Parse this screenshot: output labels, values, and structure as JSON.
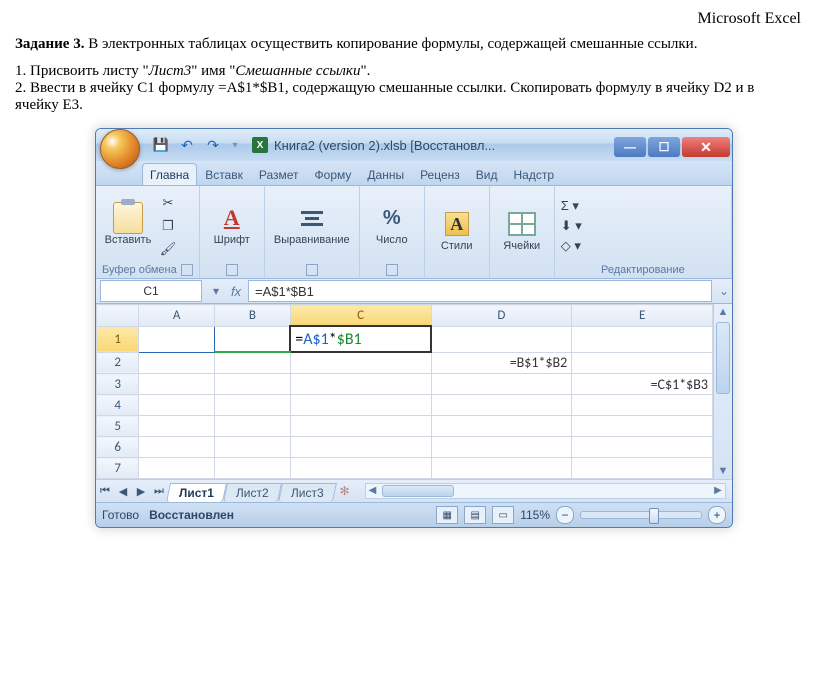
{
  "page": {
    "top_label": "Microsoft Excel",
    "task_title": "Задание 3.",
    "task_text": " В электронных таблицах осуществить копирование формулы, содержащей смешанные ссылки.",
    "step1_a": "1. Присвоить листу \"",
    "step1_i1": "Лист3",
    "step1_b": "\" имя \"",
    "step1_i2": "Смешанные ссылки",
    "step1_c": "\".",
    "step2": "2. Ввести в ячейку С1 формулу =A$1*$B1, содержащую смешанные ссылки. Скопировать формулу в ячейку D2 и в ячейку Е3."
  },
  "window": {
    "title": "Книга2 (version 2).xlsb [Восстановл...",
    "tabs": [
      "Главна",
      "Вставк",
      "Размет",
      "Форму",
      "Данны",
      "Реценз",
      "Вид",
      "Надстр"
    ],
    "groups": {
      "clipboard": {
        "paste": "Вставить",
        "label": "Буфер обмена"
      },
      "font": {
        "btn": "Шрифт"
      },
      "align": {
        "btn": "Выравнивание"
      },
      "number": {
        "btn": "Число"
      },
      "styles": {
        "btn": "Стили"
      },
      "cells": {
        "btn": "Ячейки"
      },
      "editing": {
        "label": "Редактирование"
      }
    },
    "namebox": "C1",
    "formula": "=A$1*$B1",
    "columns": [
      "A",
      "B",
      "C",
      "D",
      "E"
    ],
    "rows": [
      "1",
      "2",
      "3",
      "4",
      "5",
      "6",
      "7"
    ],
    "c1": {
      "eq": "=",
      "ref1": "A$1",
      "op": "*",
      "ref2": "$B1"
    },
    "d2": "=B$1*$B2",
    "e3": "=C$1*$B3",
    "sheets": [
      "Лист1",
      "Лист2",
      "Лист3"
    ],
    "status": {
      "ready": "Готово",
      "mode": "Восстановлен",
      "zoom": "115%"
    }
  }
}
